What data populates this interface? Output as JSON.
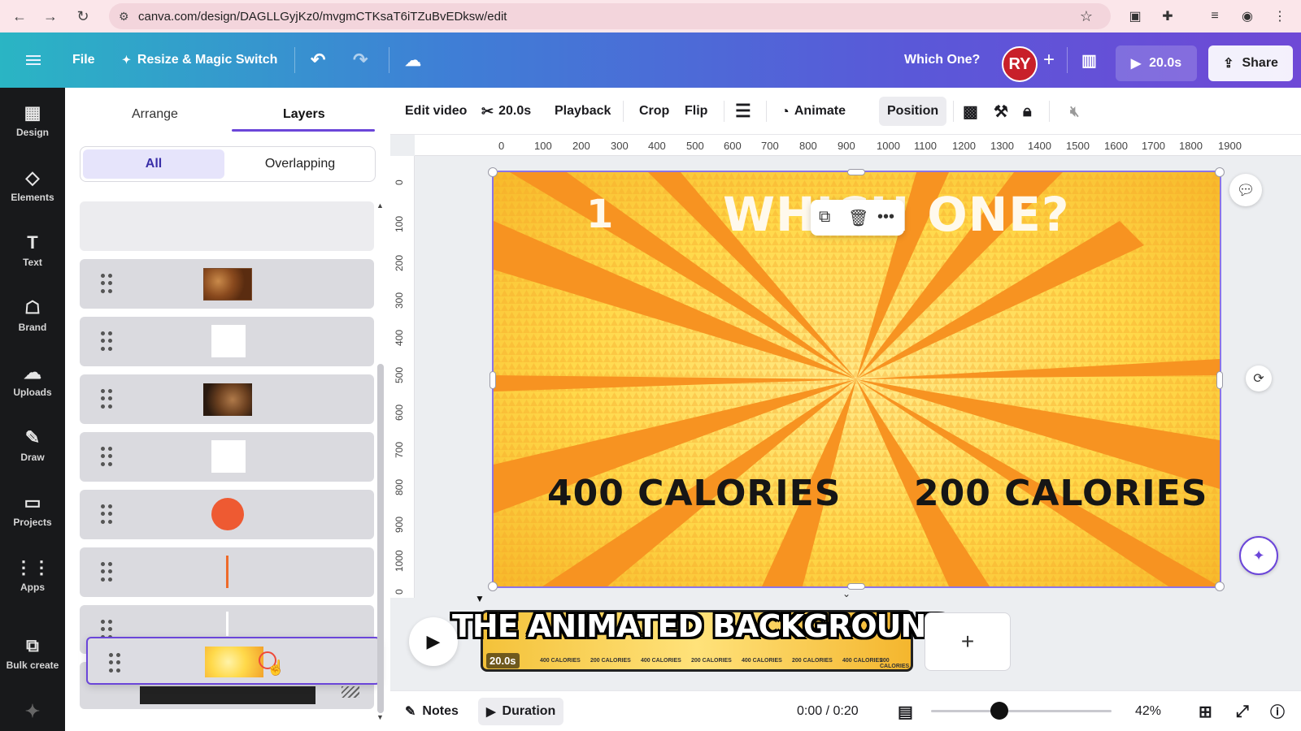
{
  "browser": {
    "url": "canva.com/design/DAGLLGyjKz0/mvgmCTKsaT6iTZuBvEDksw/edit"
  },
  "header": {
    "file_label": "File",
    "resize_label": "Resize & Magic Switch",
    "title": "Which One?",
    "avatar_initials": "RY",
    "play_duration": "20.0s",
    "share_label": "Share"
  },
  "rail": {
    "items": [
      {
        "label": "Design",
        "icon": "design-icon"
      },
      {
        "label": "Elements",
        "icon": "elements-icon"
      },
      {
        "label": "Text",
        "icon": "text-icon"
      },
      {
        "label": "Brand",
        "icon": "brand-icon"
      },
      {
        "label": "Uploads",
        "icon": "uploads-icon"
      },
      {
        "label": "Draw",
        "icon": "draw-icon"
      },
      {
        "label": "Projects",
        "icon": "projects-icon"
      },
      {
        "label": "Apps",
        "icon": "apps-icon"
      },
      {
        "label": "Bulk create",
        "icon": "bulk-create-icon"
      }
    ]
  },
  "panel": {
    "tabs": [
      {
        "label": "Arrange"
      },
      {
        "label": "Layers"
      }
    ],
    "filter": {
      "all": "All",
      "overlapping": "Overlapping"
    }
  },
  "toolbar": {
    "edit_video": "Edit video",
    "trim_duration": "20.0s",
    "playback": "Playback",
    "crop": "Crop",
    "flip": "Flip",
    "animate": "Animate",
    "position": "Position"
  },
  "ruler": {
    "h": [
      "0",
      "100",
      "200",
      "300",
      "400",
      "500",
      "600",
      "700",
      "800",
      "900",
      "1000",
      "1100",
      "1200",
      "1300",
      "1400",
      "1500",
      "1600",
      "1700",
      "1800",
      "1900"
    ],
    "v": [
      "0",
      "100",
      "200",
      "300",
      "400",
      "500",
      "600",
      "700",
      "800",
      "900",
      "1000",
      "0"
    ]
  },
  "design": {
    "number": "1",
    "title": "WHICH ONE?",
    "left_calories": "400 CALORIES",
    "right_calories": "200 CALORIES"
  },
  "timeline": {
    "overlay_title": "THE ANIMATED BACKGROUND",
    "clip_duration": "20.0s",
    "mini_labels": [
      "400 CALORIES",
      "200 CALORIES",
      "400 CALORIES",
      "200 CALORIES",
      "400 CALORIES",
      "200 CALORIES",
      "400 CALORIES",
      "200 CALORIES"
    ]
  },
  "footer": {
    "notes": "Notes",
    "duration": "Duration",
    "time": "0:00 / 0:20",
    "zoom": "42%"
  },
  "colors": {
    "accent": "#6b46d9",
    "avatar": "#c8202a",
    "design_yellow": "#ffd94a",
    "ray_orange": "#f7931e"
  }
}
